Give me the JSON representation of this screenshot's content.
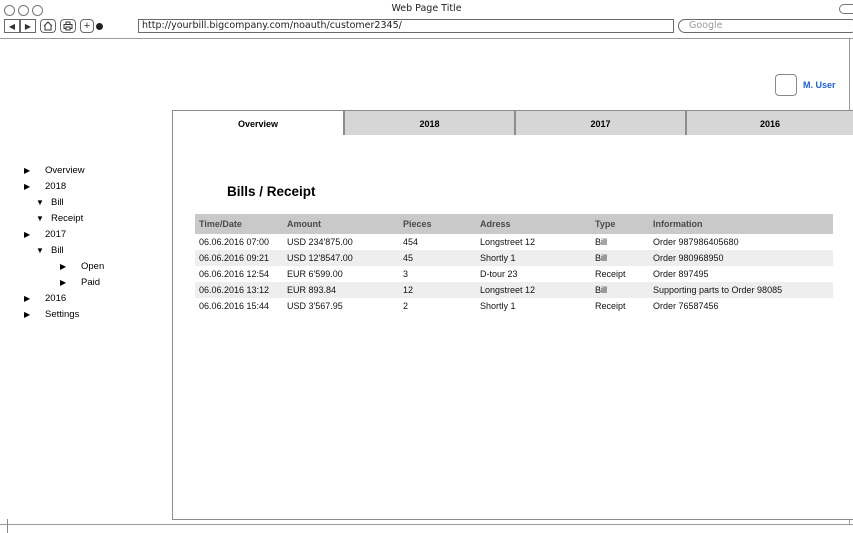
{
  "window": {
    "title": "Web Page Title"
  },
  "browser": {
    "url": "http://yourbill.bigcompany.com/noauth/customer2345/",
    "search_placeholder": "Google"
  },
  "user": {
    "name": "M. User"
  },
  "tabs": [
    {
      "label": "Overview",
      "active": true
    },
    {
      "label": "2018",
      "active": false
    },
    {
      "label": "2017",
      "active": false
    },
    {
      "label": "2016",
      "active": false
    }
  ],
  "sidebar": {
    "items": [
      {
        "label": "Overview",
        "glyph": "▶"
      },
      {
        "label": "2018",
        "glyph": "▶"
      },
      {
        "label": "Bill",
        "glyph": "▼"
      },
      {
        "label": "Receipt",
        "glyph": "▼"
      },
      {
        "label": "2017",
        "glyph": "▶"
      },
      {
        "label": "Bill",
        "glyph": "▼"
      },
      {
        "label": "Open",
        "glyph": "▶"
      },
      {
        "label": "Paid",
        "glyph": "▶"
      },
      {
        "label": "2016",
        "glyph": "▶"
      },
      {
        "label": "Settings",
        "glyph": "▶"
      }
    ]
  },
  "content": {
    "title": "Bills / Receipt",
    "columns": [
      "Time/Date",
      "Amount",
      "Pieces",
      "Adress",
      "Type",
      "Information"
    ],
    "rows": [
      [
        "06.06.2016 07:00",
        "USD 234'875.00",
        "454",
        "Longstreet 12",
        "Bill",
        "Order 987986405680"
      ],
      [
        "06.06.2016 09:21",
        "USD 12'8547.00",
        "45",
        "Shortly 1",
        "Bill",
        "Order 980968950"
      ],
      [
        "06.06.2016 12:54",
        "EUR 6'599.00",
        "3",
        "D-tour 23",
        "Receipt",
        "Order 897495"
      ],
      [
        "06.06.2016 13:12",
        "EUR 893.84",
        "12",
        "Longstreet 12",
        "Bill",
        "Supporting parts to Order 98085"
      ],
      [
        "06.06.2016 15:44",
        "USD 3'567.95",
        "2",
        "Shortly 1",
        "Receipt",
        "Order 76587456"
      ]
    ]
  },
  "colors": {
    "user_link": "#1f5fcf",
    "table_header": "#c9c9c9",
    "tab_inactive": "#d6d6d6"
  }
}
